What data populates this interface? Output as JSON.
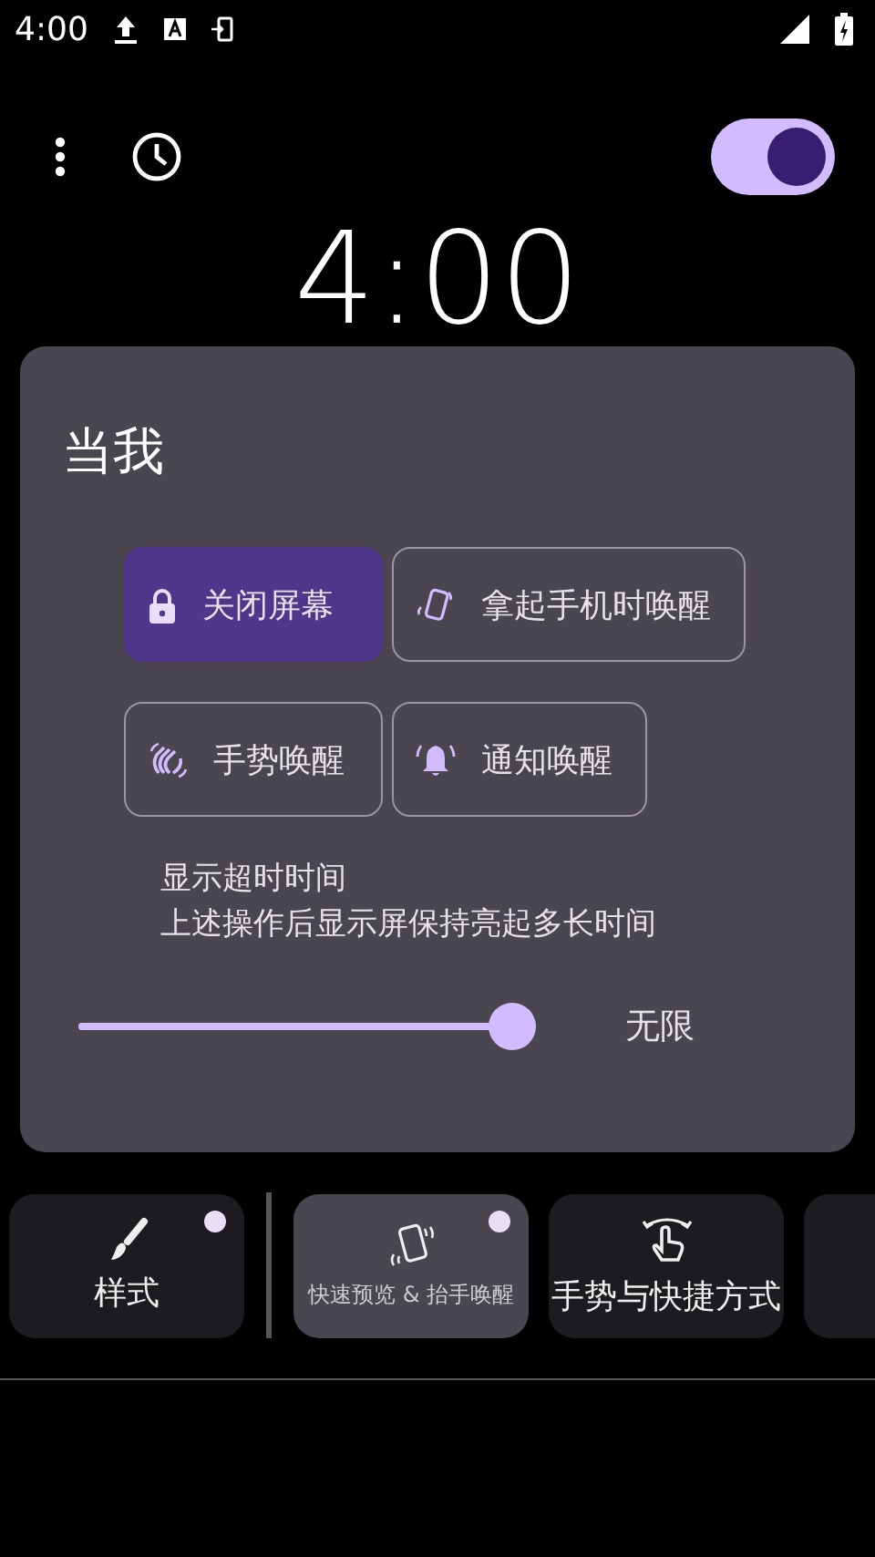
{
  "status_bar": {
    "time": "4:00"
  },
  "toolbar": {
    "switch_on": true
  },
  "clock": "4:00",
  "dialog": {
    "title": "当我",
    "options": [
      {
        "kind": "lock",
        "label": "关闭屏幕",
        "selected": true
      },
      {
        "kind": "phone",
        "label": "拿起手机时唤醒",
        "selected": false
      },
      {
        "kind": "wave",
        "label": "手势唤醒",
        "selected": false
      },
      {
        "kind": "bell",
        "label": "通知唤醒",
        "selected": false
      }
    ],
    "timeout_title": "显示超时时间",
    "timeout_desc": "上述操作后显示屏保持亮起多长时间",
    "slider": {
      "level": 1.0,
      "reading": "无限"
    }
  },
  "tabs": [
    {
      "kind": "brush",
      "label": "样式",
      "selected": false,
      "dot": true
    },
    {
      "kind": "phone",
      "label": "快速预览 & 抬手唤醒",
      "selected": true,
      "dot": true
    },
    {
      "kind": "gesture",
      "label": "手势与快捷方式",
      "selected": false,
      "dot": false
    }
  ]
}
